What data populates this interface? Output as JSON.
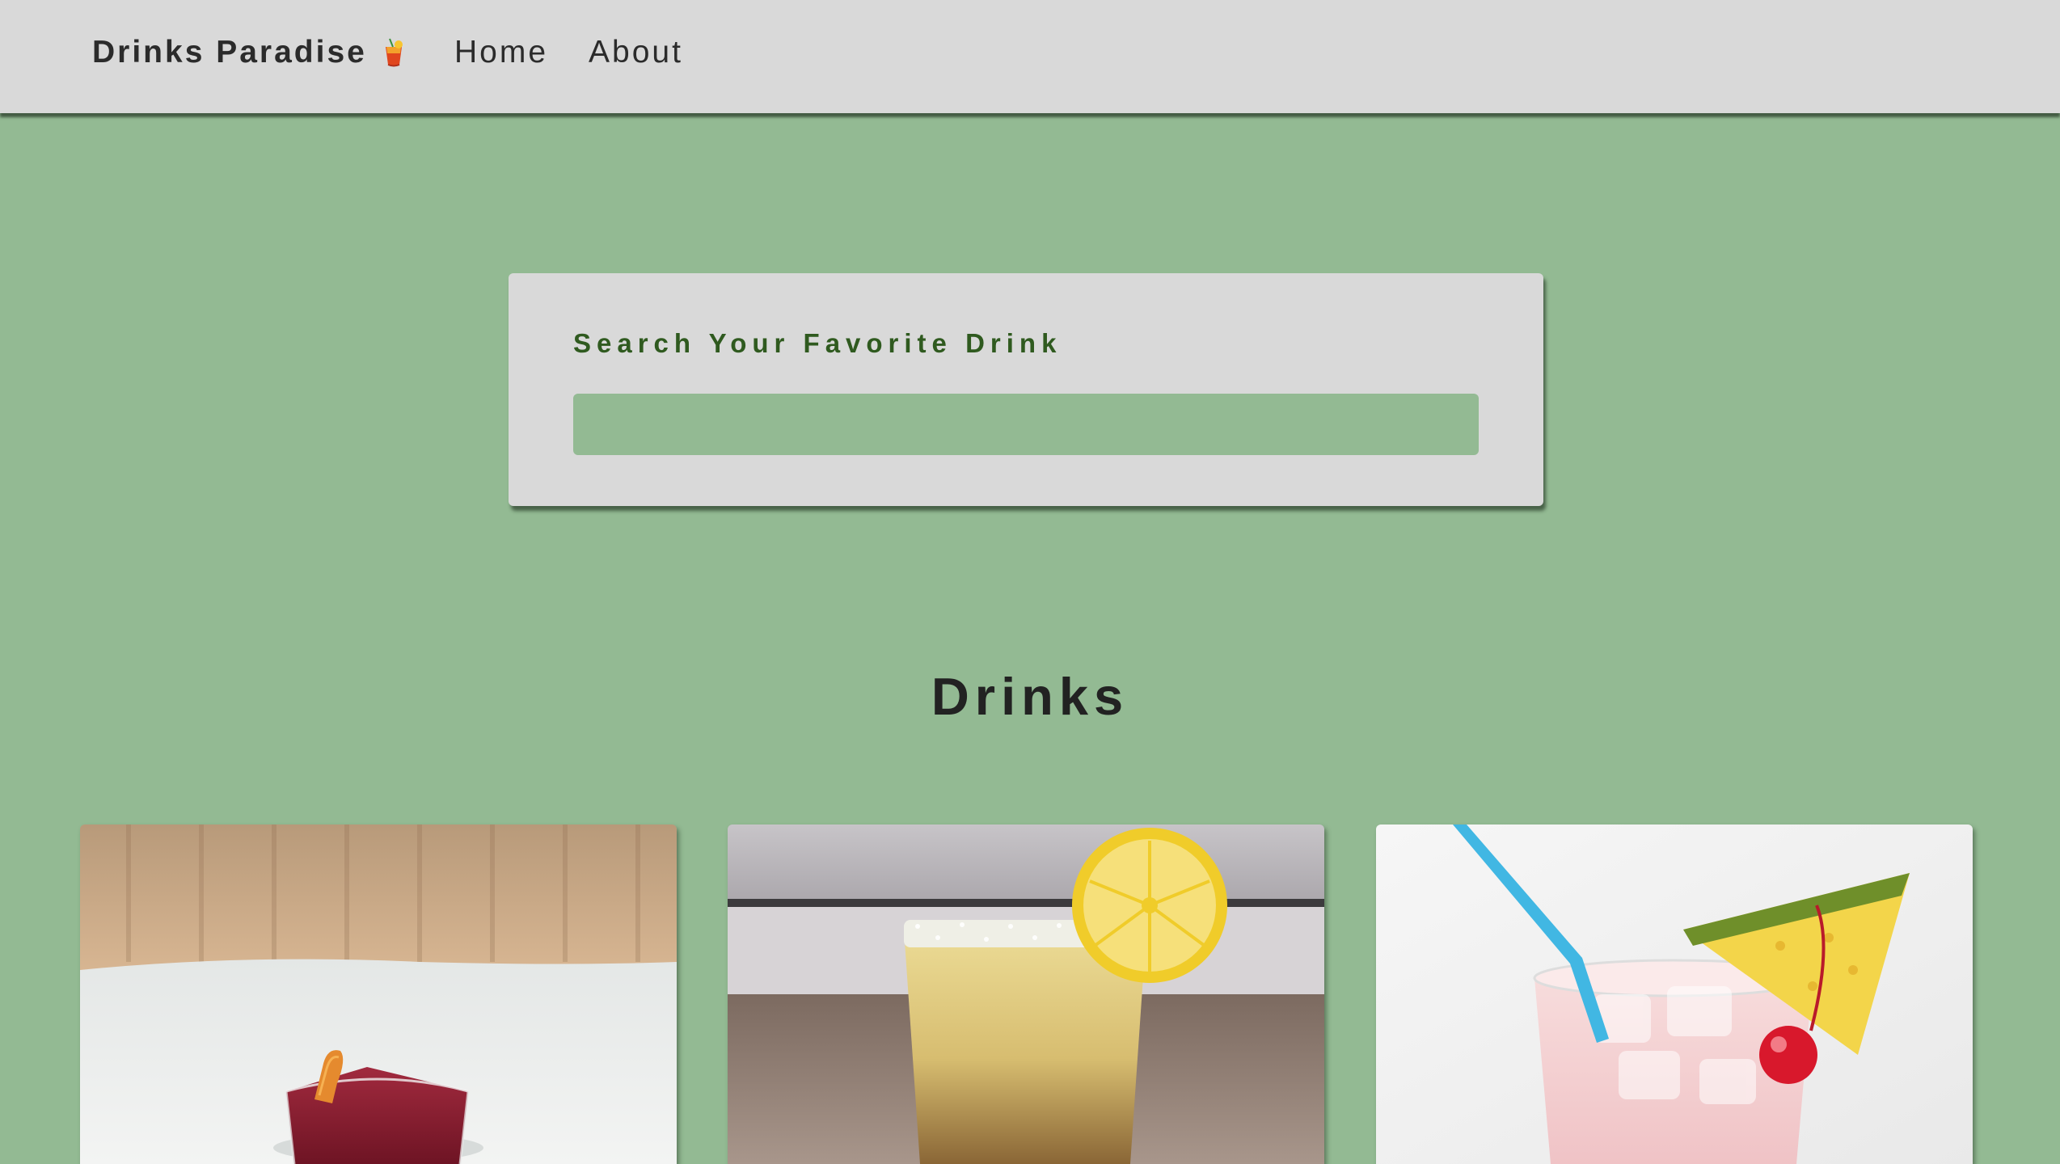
{
  "navbar": {
    "brand": "Drinks Paradise",
    "brand_icon": "tropical-drink-icon",
    "links": [
      {
        "label": "Home"
      },
      {
        "label": "About"
      }
    ]
  },
  "search": {
    "label": "Search Your Favorite Drink",
    "value": "",
    "placeholder": ""
  },
  "drinks_section": {
    "title": "Drinks",
    "cards": [
      {
        "image": "red-cocktail-with-orange-peel"
      },
      {
        "image": "lemon-drink-with-salted-rim"
      },
      {
        "image": "pink-drink-with-pineapple-and-cherry"
      }
    ]
  },
  "colors": {
    "page_background": "#93ba93",
    "panel_background": "#d9d9d9",
    "search_label": "#2f5a1f",
    "text": "#222222"
  }
}
